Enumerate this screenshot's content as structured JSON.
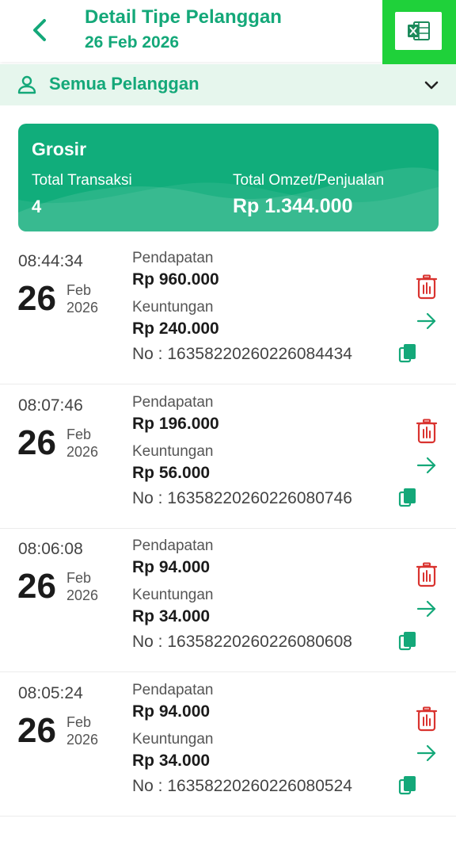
{
  "header": {
    "title": "Detail Tipe Pelanggan",
    "date": "26 Feb 2026",
    "back_icon": "chevron-left-icon",
    "export_icon": "excel-icon"
  },
  "filter": {
    "label": "Semua Pelanggan",
    "icon": "person-icon",
    "dropdown_icon": "chevron-down-icon"
  },
  "summary": {
    "name": "Grosir",
    "transactions_label": "Total Transaksi",
    "transactions_value": "4",
    "omzet_label": "Total Omzet/Penjualan",
    "omzet_value": "Rp 1.344.000"
  },
  "transactions": [
    {
      "time": "08:44:34",
      "day": "26",
      "month": "Feb",
      "year": "2026",
      "income_label": "Pendapatan",
      "income": "Rp 960.000",
      "profit_label": "Keuntungan",
      "profit": "Rp 240.000",
      "number": "No : 16358220260226084434"
    },
    {
      "time": "08:07:46",
      "day": "26",
      "month": "Feb",
      "year": "2026",
      "income_label": "Pendapatan",
      "income": "Rp 196.000",
      "profit_label": "Keuntungan",
      "profit": "Rp 56.000",
      "number": "No : 16358220260226080746"
    },
    {
      "time": "08:06:08",
      "day": "26",
      "month": "Feb",
      "year": "2026",
      "income_label": "Pendapatan",
      "income": "Rp 94.000",
      "profit_label": "Keuntungan",
      "profit": "Rp 34.000",
      "number": "No : 16358220260226080608"
    },
    {
      "time": "08:05:24",
      "day": "26",
      "month": "Feb",
      "year": "2026",
      "income_label": "Pendapatan",
      "income": "Rp 94.000",
      "profit_label": "Keuntungan",
      "profit": "Rp 34.000",
      "number": "No : 16358220260226080524"
    }
  ],
  "colors": {
    "primary": "#14a879",
    "card": "#11ad7b",
    "highlight": "#1fd13a",
    "filter_bg": "#e6f6ed",
    "delete": "#d9332f"
  }
}
